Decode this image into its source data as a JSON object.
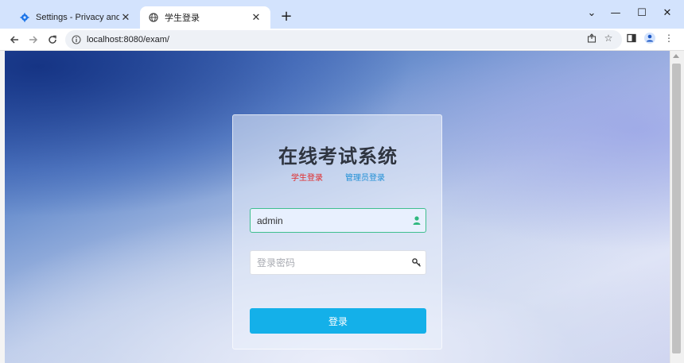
{
  "browser": {
    "tabs": [
      {
        "title": "Settings - Privacy and security",
        "icon": "gear-icon",
        "active": false
      },
      {
        "title": "学生登录",
        "icon": "globe-icon",
        "active": true
      }
    ],
    "new_tab": "+",
    "url": "localhost:8080/exam/",
    "window_controls": {
      "chevron": "⌄",
      "minimize": "—",
      "maximize": "☐",
      "close": "✕"
    }
  },
  "login": {
    "title": "在线考试系统",
    "role_student": "学生登录",
    "role_admin": "管理员登录",
    "username_value": "admin",
    "password_placeholder": "登录密码",
    "submit_label": "登录"
  },
  "colors": {
    "accent": "#14b0e9",
    "student_role": "#e02a2a",
    "admin_role": "#1f8fd6",
    "user_icon": "#2fb87f"
  }
}
